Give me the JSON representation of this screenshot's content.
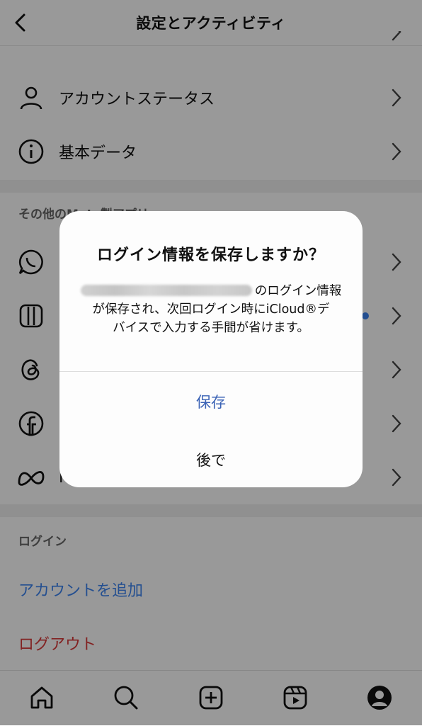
{
  "header": {
    "title": "設定とアクティビティ"
  },
  "rows_top": [
    {
      "label": "アカウントステータス",
      "icon": "person-icon"
    },
    {
      "label": "基本データ",
      "icon": "info-icon"
    }
  ],
  "section_other": {
    "title": "その他のMeta製アプリ"
  },
  "apps": [
    {
      "icon": "whatsapp-icon"
    },
    {
      "icon": "edits-icon"
    },
    {
      "icon": "threads-icon"
    },
    {
      "icon": "facebook-icon"
    },
    {
      "icon": "meta-icon",
      "label_partial": "M"
    }
  ],
  "section_login": {
    "title": "ログイン",
    "add_account": "アカウントを追加",
    "logout": "ログアウト"
  },
  "dialog": {
    "title": "ログイン情報を保存しますか？",
    "body_part1": "のログイン情報",
    "body_line2": "が保存され、次回ログイン時にiCloud®デ",
    "body_line3": "バイスで入力する手間が省けます。",
    "save": "保存",
    "later": "後で"
  },
  "tabbar": [
    "home-icon",
    "search-icon",
    "create-icon",
    "reels-icon",
    "profile-icon"
  ],
  "colors": {
    "accent_blue": "#3d84f0",
    "dialog_blue": "#3a62b5",
    "logout_red": "#d93a3a"
  }
}
